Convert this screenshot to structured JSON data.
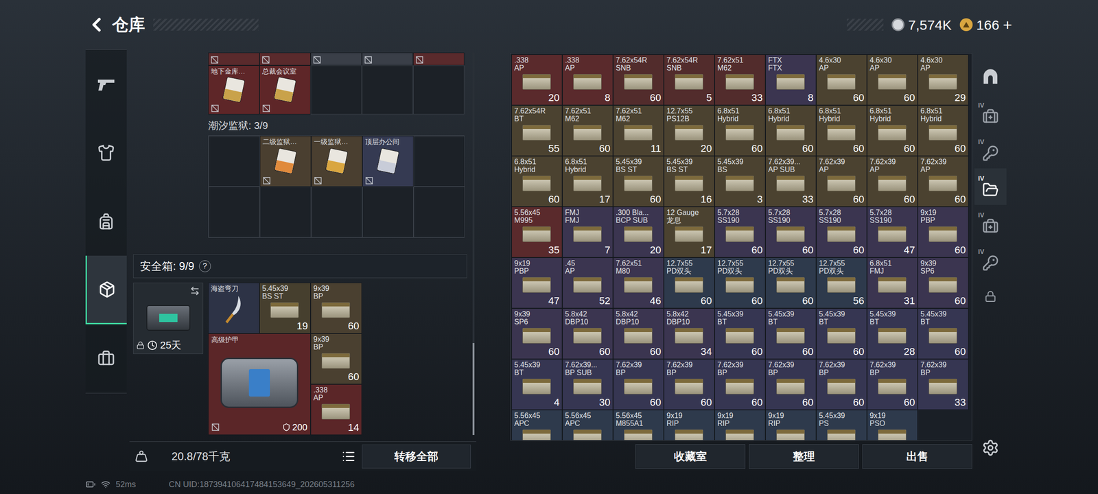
{
  "header": {
    "title": "仓库",
    "currencies": [
      {
        "value": "7,574K",
        "kind": "coin",
        "action": null
      },
      {
        "value": "166",
        "kind": "gem",
        "action": "+"
      }
    ]
  },
  "nav": [
    {
      "kind": "weapon",
      "selected": false
    },
    {
      "kind": "armor",
      "selected": false
    },
    {
      "kind": "backpack",
      "selected": false
    },
    {
      "kind": "safebox",
      "selected": true
    },
    {
      "kind": "toolbox",
      "selected": false
    }
  ],
  "left_panel": {
    "partial_row": [
      {
        "filled": true,
        "color": "#5a2a2c"
      },
      {
        "filled": true,
        "color": "#5a2a2c"
      },
      {
        "filled": true,
        "color": "#3a3f48"
      },
      {
        "filled": true,
        "color": "#3a3f48"
      },
      {
        "filled": true,
        "color": "#5a2a2c"
      }
    ],
    "vault_cards": [
      {
        "label": "地下金库…",
        "color": "#5e2628",
        "card": "#c9a24a",
        "untradable": true
      },
      {
        "label": "总裁会议室",
        "color": "#5e2628",
        "card": "#c9a24a",
        "untradable": true
      },
      {
        "label": null
      },
      {
        "label": null
      },
      {
        "label": null
      }
    ],
    "prison": {
      "title": "潮汐监狱: 3/9",
      "cells": [
        {
          "label": null
        },
        {
          "label": "二级监狱…",
          "color": "#4a3f30",
          "card": "#e08a3c",
          "untradable": true
        },
        {
          "label": "一级监狱…",
          "color": "#4a3f30",
          "card": "#d9a640",
          "untradable": true
        },
        {
          "label": "顶层办公间",
          "color": "#353a52",
          "card": "#c8ccd8",
          "untradable": true
        },
        {
          "label": null
        },
        {
          "label": null
        },
        {
          "label": null
        },
        {
          "label": null
        },
        {
          "label": null
        },
        {
          "label": null
        }
      ]
    },
    "safe_box": {
      "title": "安全箱: 9/9",
      "help": "?",
      "days": "25天",
      "locked": true,
      "items": [
        {
          "kind": "knife",
          "name": "海盗弯刀",
          "color": "#2d3346"
        },
        {
          "kind": "ammo",
          "caliber": "5.45x39",
          "type": "BS ST",
          "count": "19",
          "color": "#463f2e"
        },
        {
          "kind": "ammo",
          "caliber": "9x39",
          "type": "BP",
          "count": "60",
          "color": "#4a4030"
        },
        {
          "kind": "armor",
          "name": "高级护甲",
          "durability": "200",
          "color": "#5b2628",
          "untradable": true
        },
        {
          "kind": "ammo",
          "caliber": "9x39",
          "type": "BP",
          "count": "60",
          "color": "#4a4030"
        },
        {
          "kind": "ammo",
          "caliber": ".338",
          "type": "AP",
          "count": "14",
          "color": "#5b2628"
        }
      ]
    },
    "scrollbar": {
      "level": 0.24
    },
    "weight": "20.8/78千克",
    "transfer_button": "转移全部"
  },
  "stash": {
    "items": [
      {
        "caliber": ".338",
        "type": "AP",
        "count": "20",
        "color": "#5a2a2c"
      },
      {
        "caliber": ".338",
        "type": "AP",
        "count": "8",
        "color": "#5a2a2c"
      },
      {
        "caliber": "7.62x54R",
        "type": "SNB",
        "count": "60",
        "color": "#522c2c"
      },
      {
        "caliber": "7.62x54R",
        "type": "SNB",
        "count": "5",
        "color": "#522c2c"
      },
      {
        "caliber": "7.62x51",
        "type": "M62",
        "count": "33",
        "color": "#522c2c"
      },
      {
        "caliber": "FTX",
        "type": "FTX",
        "count": "8",
        "color": "#3b3550"
      },
      {
        "caliber": "4.6x30",
        "type": "AP",
        "count": "60",
        "color": "#4b4230"
      },
      {
        "caliber": "4.6x30",
        "type": "AP",
        "count": "60",
        "color": "#4b4230"
      },
      {
        "caliber": "4.6x30",
        "type": "AP",
        "count": "29",
        "color": "#4b4230"
      },
      {
        "caliber": "7.62x54R",
        "type": "BT",
        "count": "55",
        "color": "#4b4230"
      },
      {
        "caliber": "7.62x51",
        "type": "M62",
        "count": "60",
        "color": "#4b4230"
      },
      {
        "caliber": "7.62x51",
        "type": "M62",
        "count": "11",
        "color": "#4b4230"
      },
      {
        "caliber": "12.7x55",
        "type": "PS12B",
        "count": "20",
        "color": "#4b4230"
      },
      {
        "caliber": "6.8x51",
        "type": "Hybrid",
        "count": "60",
        "color": "#4b4230"
      },
      {
        "caliber": "6.8x51",
        "type": "Hybrid",
        "count": "60",
        "color": "#4b4230"
      },
      {
        "caliber": "6.8x51",
        "type": "Hybrid",
        "count": "60",
        "color": "#4b4230"
      },
      {
        "caliber": "6.8x51",
        "type": "Hybrid",
        "count": "60",
        "color": "#4b4230"
      },
      {
        "caliber": "6.8x51",
        "type": "Hybrid",
        "count": "60",
        "color": "#4b4230"
      },
      {
        "caliber": "6.8x51",
        "type": "Hybrid",
        "count": "60",
        "color": "#4b4230"
      },
      {
        "caliber": "6.8x51",
        "type": "Hybrid",
        "count": "17",
        "color": "#4b4230"
      },
      {
        "caliber": "5.45x39",
        "type": "BS ST",
        "count": "60",
        "color": "#4b4230"
      },
      {
        "caliber": "5.45x39",
        "type": "BS ST",
        "count": "16",
        "color": "#4b4230"
      },
      {
        "caliber": "5.45x39",
        "type": "BS",
        "count": "3",
        "color": "#4b4230"
      },
      {
        "caliber": "7.62x39...",
        "type": "AP SUB",
        "count": "33",
        "color": "#4b4230"
      },
      {
        "caliber": "7.62x39",
        "type": "AP",
        "count": "60",
        "color": "#4b4230"
      },
      {
        "caliber": "7.62x39",
        "type": "AP",
        "count": "60",
        "color": "#4b4230"
      },
      {
        "caliber": "7.62x39",
        "type": "AP",
        "count": "60",
        "color": "#4b4230"
      },
      {
        "caliber": "5.56x45",
        "type": "M995",
        "count": "35",
        "color": "#5a2a2c"
      },
      {
        "caliber": "FMJ",
        "type": "FMJ",
        "count": "7",
        "color": "#3b3550"
      },
      {
        "caliber": ".300 Bla...",
        "type": "BCP SUB",
        "count": "20",
        "color": "#3b3550"
      },
      {
        "caliber": "12 Gauge",
        "type": "龙息",
        "count": "17",
        "color": "#4b4230"
      },
      {
        "caliber": "5.7x28",
        "type": "SS190",
        "count": "60",
        "color": "#3b3550"
      },
      {
        "caliber": "5.7x28",
        "type": "SS190",
        "count": "60",
        "color": "#3b3550"
      },
      {
        "caliber": "5.7x28",
        "type": "SS190",
        "count": "60",
        "color": "#3b3550"
      },
      {
        "caliber": "5.7x28",
        "type": "SS190",
        "count": "47",
        "color": "#3b3550"
      },
      {
        "caliber": "9x19",
        "type": "PBP",
        "count": "60",
        "color": "#3b3550"
      },
      {
        "caliber": "9x19",
        "type": "PBP",
        "count": "47",
        "color": "#3b3550"
      },
      {
        "caliber": ".45",
        "type": "AP",
        "count": "52",
        "color": "#3b3550"
      },
      {
        "caliber": "7.62x51",
        "type": "M80",
        "count": "46",
        "color": "#3b3550"
      },
      {
        "caliber": "12.7x55",
        "type": "PD双头",
        "count": "60",
        "color": "#2e3a4c"
      },
      {
        "caliber": "12.7x55",
        "type": "PD双头",
        "count": "60",
        "color": "#2e3a4c"
      },
      {
        "caliber": "12.7x55",
        "type": "PD双头",
        "count": "60",
        "color": "#2e3a4c"
      },
      {
        "caliber": "12.7x55",
        "type": "PD双头",
        "count": "56",
        "color": "#2e3a4c"
      },
      {
        "caliber": "6.8x51",
        "type": "FMJ",
        "count": "31",
        "color": "#3b3550"
      },
      {
        "caliber": "9x39",
        "type": "SP6",
        "count": "60",
        "color": "#3b3550"
      },
      {
        "caliber": "9x39",
        "type": "SP6",
        "count": "60",
        "color": "#3b3550"
      },
      {
        "caliber": "5.8x42",
        "type": "DBP10",
        "count": "60",
        "color": "#3b3550"
      },
      {
        "caliber": "5.8x42",
        "type": "DBP10",
        "count": "60",
        "color": "#3b3550"
      },
      {
        "caliber": "5.8x42",
        "type": "DBP10",
        "count": "34",
        "color": "#3b3550"
      },
      {
        "caliber": "5.45x39",
        "type": "BT",
        "count": "60",
        "color": "#363652"
      },
      {
        "caliber": "5.45x39",
        "type": "BT",
        "count": "60",
        "color": "#363652"
      },
      {
        "caliber": "5.45x39",
        "type": "BT",
        "count": "60",
        "color": "#363652"
      },
      {
        "caliber": "5.45x39",
        "type": "BT",
        "count": "28",
        "color": "#363652"
      },
      {
        "caliber": "5.45x39",
        "type": "BT",
        "count": "60",
        "color": "#363652"
      },
      {
        "caliber": "5.45x39",
        "type": "BT",
        "count": "4",
        "color": "#363652"
      },
      {
        "caliber": "7.62x39...",
        "type": "BP SUB",
        "count": "30",
        "color": "#363652"
      },
      {
        "caliber": "7.62x39",
        "type": "BP",
        "count": "60",
        "color": "#363652"
      },
      {
        "caliber": "7.62x39",
        "type": "BP",
        "count": "60",
        "color": "#363652"
      },
      {
        "caliber": "7.62x39",
        "type": "BP",
        "count": "60",
        "color": "#363652"
      },
      {
        "caliber": "7.62x39",
        "type": "BP",
        "count": "60",
        "color": "#363652"
      },
      {
        "caliber": "7.62x39",
        "type": "BP",
        "count": "60",
        "color": "#363652"
      },
      {
        "caliber": "7.62x39",
        "type": "BP",
        "count": "60",
        "color": "#363652"
      },
      {
        "caliber": "7.62x39",
        "type": "BP",
        "count": "33",
        "color": "#363652"
      },
      {
        "caliber": "5.56x45",
        "type": "APC",
        "color": "#2e3a4c"
      },
      {
        "caliber": "5.56x45",
        "type": "APC",
        "color": "#2e3a4c"
      },
      {
        "caliber": "5.56x45",
        "type": "M855A1",
        "color": "#2e3a4c"
      },
      {
        "caliber": "9x19",
        "type": "RIP",
        "color": "#2e3a4c"
      },
      {
        "caliber": "9x19",
        "type": "RIP",
        "color": "#2e3a4c"
      },
      {
        "caliber": "9x19",
        "type": "RIP",
        "color": "#2e3a4c"
      },
      {
        "caliber": "5.45x39",
        "type": "PS",
        "color": "#2e3a4c"
      },
      {
        "caliber": "9x19",
        "type": "PSO",
        "color": "#2e3a4c"
      }
    ]
  },
  "buttons": [
    "收藏室",
    "整理",
    "出售"
  ],
  "right_sidebar": [
    {
      "kind": "vault",
      "badge": null,
      "selected": false
    },
    {
      "kind": "medkit",
      "badge": "IV",
      "selected": false
    },
    {
      "kind": "keys",
      "badge": "IV",
      "selected": false
    },
    {
      "kind": "files",
      "badge": "IV",
      "selected": true
    },
    {
      "kind": "medkit",
      "badge": "IV",
      "selected": false
    },
    {
      "kind": "keys",
      "badge": "IV",
      "selected": false
    },
    {
      "kind": "lock",
      "badge": null,
      "selected": false
    }
  ],
  "status_bar": {
    "ping": "52ms",
    "uid": "CN UID:187394106417484153649_202605311256"
  }
}
